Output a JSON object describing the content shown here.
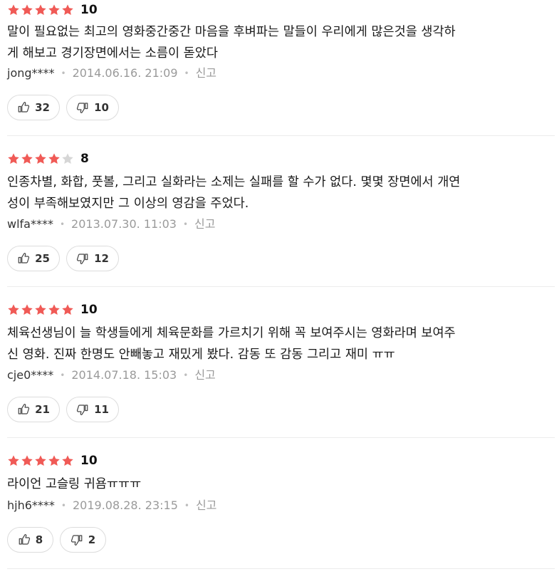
{
  "colors": {
    "star_on": "#f05a56",
    "star_off": "#d6d6d6"
  },
  "icons": {
    "like": "thumbs-up-icon",
    "dislike": "thumbs-down-icon",
    "star": "star-icon"
  },
  "reviews": [
    {
      "stars_filled": 5,
      "stars_total": 5,
      "score": "10",
      "lines": [
        "말이 필요없는 최고의 영화중간중간 마음을 후벼파는 말들이 우리에게 많은것을 생각하",
        "게 해보고 경기장면에서는 소름이 돋았다"
      ],
      "user": "jong****",
      "date": "2014.06.16. 21:09",
      "report": "신고",
      "likes": "32",
      "dislikes": "10"
    },
    {
      "stars_filled": 4,
      "stars_total": 5,
      "score": "8",
      "lines": [
        "인종차별, 화합, 풋볼, 그리고 실화라는 소제는 실패를 할 수가 없다. 몇몇 장면에서 개연",
        "성이 부족해보였지만 그 이상의 영감을 주었다."
      ],
      "user": "wlfa****",
      "date": "2013.07.30. 11:03",
      "report": "신고",
      "likes": "25",
      "dislikes": "12"
    },
    {
      "stars_filled": 5,
      "stars_total": 5,
      "score": "10",
      "lines": [
        "체육선생님이 늘 학생들에게 체육문화를 가르치기 위해 꼭 보여주시는 영화라며 보여주",
        "신 영화. 진짜 한명도 안빼놓고 재밌게 봤다. 감동 또 감동 그리고 재미 ㅠㅠ"
      ],
      "user": "cje0****",
      "date": "2014.07.18. 15:03",
      "report": "신고",
      "likes": "21",
      "dislikes": "11"
    },
    {
      "stars_filled": 5,
      "stars_total": 5,
      "score": "10",
      "lines": [
        "라이언 고슬링 귀욤ㅠㅠㅠ"
      ],
      "user": "hjh6****",
      "date": "2019.08.28. 23:15",
      "report": "신고",
      "likes": "8",
      "dislikes": "2"
    }
  ]
}
